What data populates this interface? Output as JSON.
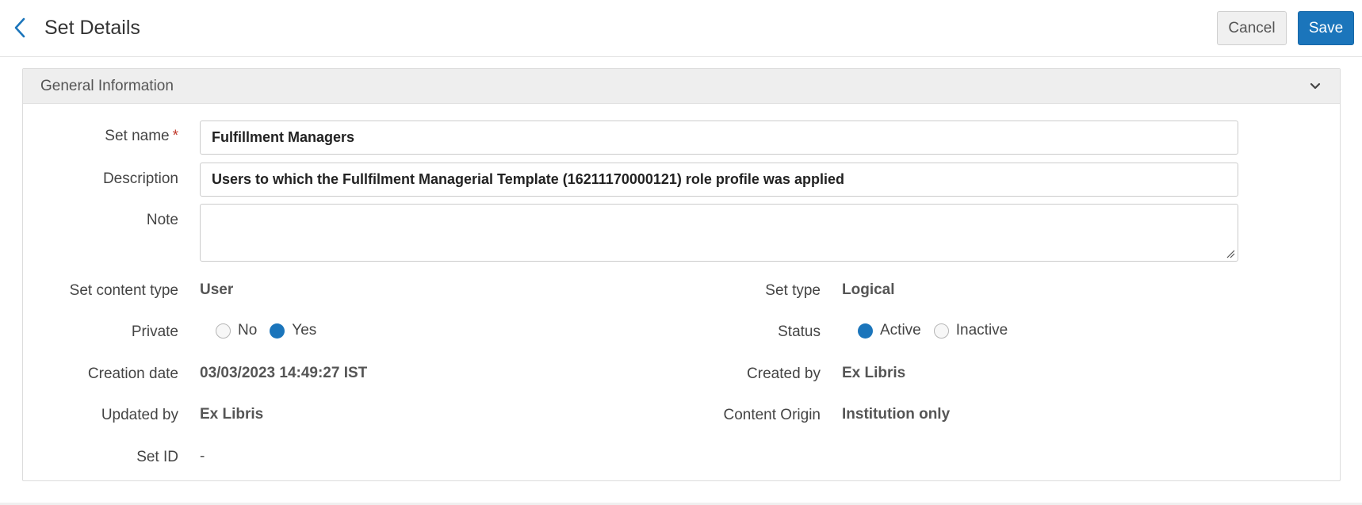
{
  "header": {
    "title": "Set Details",
    "cancel_label": "Cancel",
    "save_label": "Save"
  },
  "panel": {
    "title": "General Information"
  },
  "form": {
    "set_name": {
      "label": "Set name",
      "required_mark": "*",
      "value": "Fulfillment Managers"
    },
    "description": {
      "label": "Description",
      "value": "Users to which the Fullfilment Managerial Template (16211170000121) role profile was applied"
    },
    "note": {
      "label": "Note",
      "value": ""
    },
    "set_content_type": {
      "label": "Set content type",
      "value": "User"
    },
    "set_type": {
      "label": "Set type",
      "value": "Logical"
    },
    "private": {
      "label": "Private",
      "options": [
        "No",
        "Yes"
      ],
      "selected": "Yes"
    },
    "status": {
      "label": "Status",
      "options": [
        "Active",
        "Inactive"
      ],
      "selected": "Active"
    },
    "creation_date": {
      "label": "Creation date",
      "value": "03/03/2023 14:49:27 IST"
    },
    "created_by": {
      "label": "Created by",
      "value": "Ex Libris"
    },
    "updated_by": {
      "label": "Updated by",
      "value": "Ex Libris"
    },
    "content_origin": {
      "label": "Content Origin",
      "value": "Institution only"
    },
    "set_id": {
      "label": "Set ID",
      "value": "-"
    }
  },
  "colors": {
    "accent": "#1b75bb",
    "required": "#c0392b"
  },
  "icons": {
    "back": "chevron-left-icon",
    "collapse": "chevron-down-icon"
  }
}
